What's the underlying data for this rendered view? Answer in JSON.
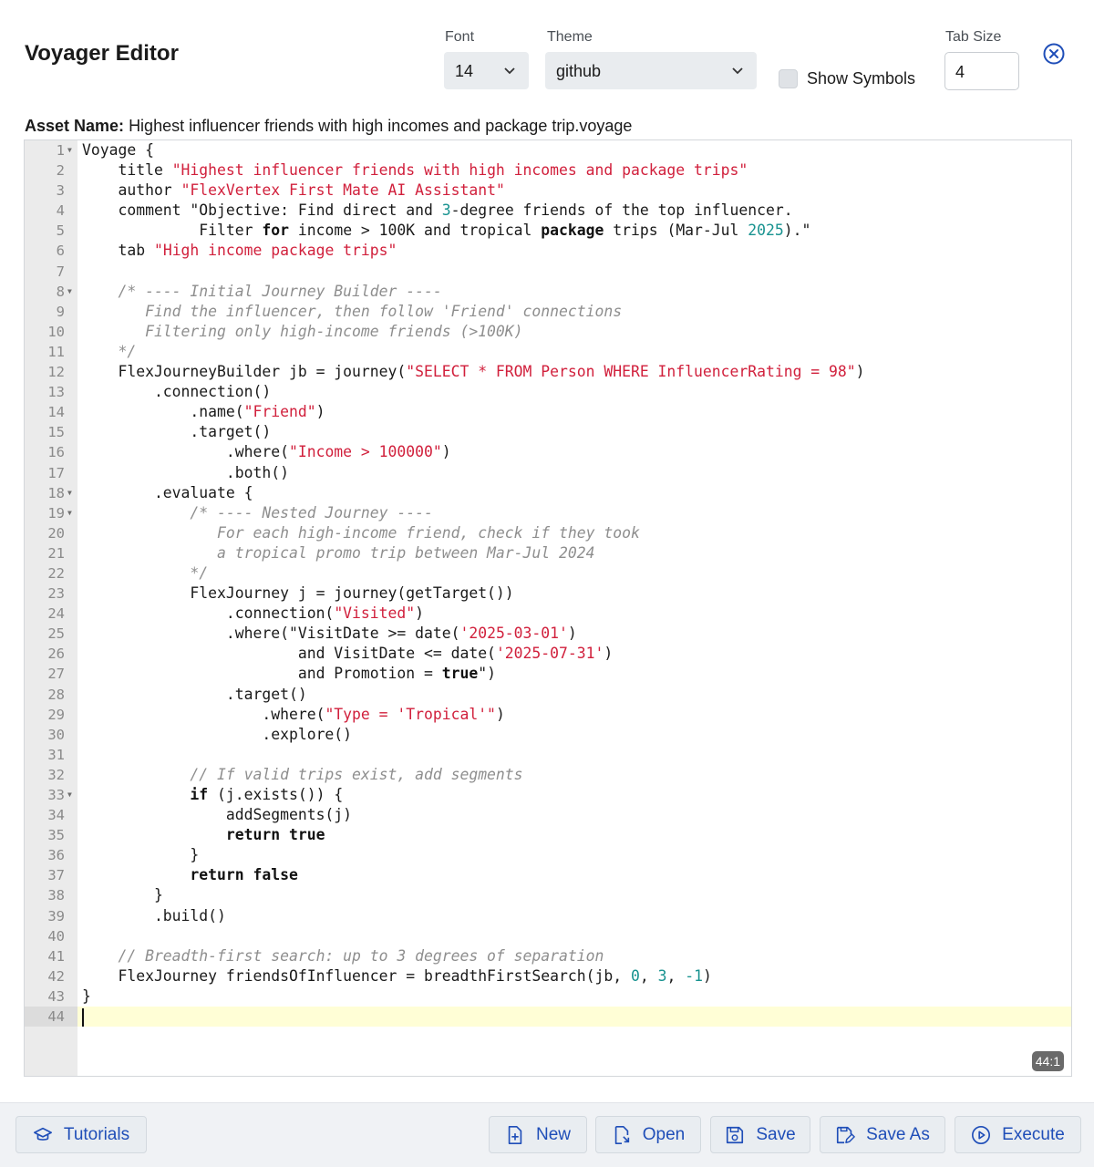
{
  "header": {
    "title": "Voyager Editor",
    "font_label": "Font",
    "font_value": "14",
    "theme_label": "Theme",
    "theme_value": "github",
    "show_symbols_label": "Show Symbols",
    "tab_size_label": "Tab Size",
    "tab_size_value": "4"
  },
  "asset": {
    "label": "Asset Name:",
    "value": "Highest influencer friends with high incomes and package trip.voyage"
  },
  "editor": {
    "status": "44:1",
    "fold_lines": [
      1,
      8,
      18,
      19,
      33
    ],
    "active_line": 44,
    "lines": [
      [
        [
          "",
          "Voyage {"
        ]
      ],
      [
        [
          "",
          "    title "
        ],
        [
          "str",
          "\"Highest influencer friends with high incomes and package trips\""
        ]
      ],
      [
        [
          "",
          "    author "
        ],
        [
          "str",
          "\"FlexVertex First Mate AI Assistant\""
        ]
      ],
      [
        [
          "",
          "    comment \"Objective: Find direct and "
        ],
        [
          "num",
          "3"
        ],
        [
          "",
          "-degree friends of the top influencer."
        ]
      ],
      [
        [
          "",
          "             Filter "
        ],
        [
          "kw",
          "for"
        ],
        [
          "",
          " income > 100K and tropical "
        ],
        [
          "kw",
          "package"
        ],
        [
          "",
          " trips (Mar-Jul "
        ],
        [
          "num",
          "2025"
        ],
        [
          "",
          ").\""
        ]
      ],
      [
        [
          "",
          "    tab "
        ],
        [
          "str",
          "\"High income package trips\""
        ]
      ],
      [
        [
          "",
          ""
        ]
      ],
      [
        [
          "com",
          "    /* ---- Initial Journey Builder ----"
        ]
      ],
      [
        [
          "com",
          "       Find the influencer, then follow 'Friend' connections"
        ]
      ],
      [
        [
          "com",
          "       Filtering only high-income friends (>100K)"
        ]
      ],
      [
        [
          "com",
          "    */"
        ]
      ],
      [
        [
          "",
          "    FlexJourneyBuilder jb = journey("
        ],
        [
          "str",
          "\"SELECT * FROM Person WHERE InfluencerRating = 98\""
        ],
        [
          "",
          ")"
        ]
      ],
      [
        [
          "",
          "        .connection()"
        ]
      ],
      [
        [
          "",
          "            .name("
        ],
        [
          "str",
          "\"Friend\""
        ],
        [
          "",
          ")"
        ]
      ],
      [
        [
          "",
          "            .target()"
        ]
      ],
      [
        [
          "",
          "                .where("
        ],
        [
          "str",
          "\"Income > 100000\""
        ],
        [
          "",
          ")"
        ]
      ],
      [
        [
          "",
          "                .both()"
        ]
      ],
      [
        [
          "",
          "        .evaluate {"
        ]
      ],
      [
        [
          "com",
          "            /* ---- Nested Journey ----"
        ]
      ],
      [
        [
          "com",
          "               For each high-income friend, check if they took"
        ]
      ],
      [
        [
          "com",
          "               a tropical promo trip between Mar-Jul 2024"
        ]
      ],
      [
        [
          "com",
          "            */"
        ]
      ],
      [
        [
          "",
          "            FlexJourney j = journey(getTarget())"
        ]
      ],
      [
        [
          "",
          "                .connection("
        ],
        [
          "str",
          "\"Visited\""
        ],
        [
          "",
          ")"
        ]
      ],
      [
        [
          "",
          "                .where(\"VisitDate >= date("
        ],
        [
          "str",
          "'2025-03-01'"
        ],
        [
          "",
          ")"
        ]
      ],
      [
        [
          "",
          "                        and VisitDate <= date("
        ],
        [
          "str",
          "'2025-07-31'"
        ],
        [
          "",
          ")"
        ]
      ],
      [
        [
          "",
          "                        and Promotion = "
        ],
        [
          "kw",
          "true"
        ],
        [
          "",
          "\")"
        ]
      ],
      [
        [
          "",
          "                .target()"
        ]
      ],
      [
        [
          "",
          "                    .where("
        ],
        [
          "str",
          "\"Type = 'Tropical'\""
        ],
        [
          "",
          ")"
        ]
      ],
      [
        [
          "",
          "                    .explore()"
        ]
      ],
      [
        [
          "",
          ""
        ]
      ],
      [
        [
          "com",
          "            // If valid trips exist, add segments"
        ]
      ],
      [
        [
          "",
          "            "
        ],
        [
          "kw",
          "if"
        ],
        [
          "",
          " (j.exists()) {"
        ]
      ],
      [
        [
          "",
          "                addSegments(j)"
        ]
      ],
      [
        [
          "",
          "                "
        ],
        [
          "kw",
          "return true"
        ]
      ],
      [
        [
          "",
          "            }"
        ]
      ],
      [
        [
          "",
          "            "
        ],
        [
          "kw",
          "return false"
        ]
      ],
      [
        [
          "",
          "        }"
        ]
      ],
      [
        [
          "",
          "        .build()"
        ]
      ],
      [
        [
          "",
          ""
        ]
      ],
      [
        [
          "com",
          "    // Breadth-first search: up to 3 degrees of separation"
        ]
      ],
      [
        [
          "",
          "    FlexJourney friendsOfInfluencer = breadthFirstSearch(jb, "
        ],
        [
          "num",
          "0"
        ],
        [
          "",
          ", "
        ],
        [
          "num",
          "3"
        ],
        [
          "",
          ", "
        ],
        [
          "num",
          "-1"
        ],
        [
          "",
          ")"
        ]
      ],
      [
        [
          "",
          "}"
        ]
      ],
      [
        [
          "",
          ""
        ]
      ]
    ]
  },
  "footer": {
    "tutorials": "Tutorials",
    "new": "New",
    "open": "Open",
    "save": "Save",
    "save_as": "Save As",
    "execute": "Execute"
  },
  "colors": {
    "accent": "#1f4eb8",
    "string": "#d1203c",
    "number": "#17928f",
    "comment": "#8e8e8e",
    "active_line": "#fffed6"
  }
}
